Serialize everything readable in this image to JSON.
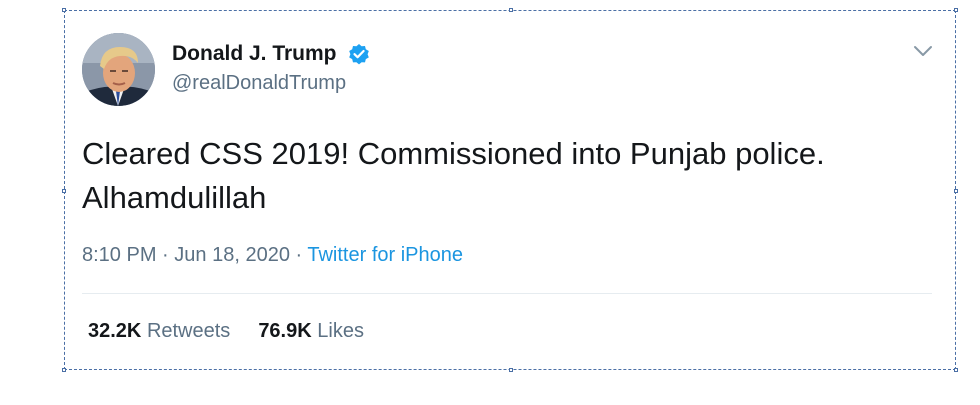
{
  "tweet": {
    "display_name": "Donald J. Trump",
    "handle": "@realDonaldTrump",
    "verified": true,
    "text_line1": "Cleared CSS 2019! Commissioned into Punjab police.",
    "text_line2": "Alhamdulillah",
    "time": "8:10 PM",
    "separator": "·",
    "date": "Jun 18, 2020",
    "source": "Twitter for iPhone",
    "retweets_count": "32.2K",
    "retweets_label": "Retweets",
    "likes_count": "76.9K",
    "likes_label": "Likes"
  },
  "icons": {
    "verified": "verified-badge-icon",
    "menu": "chevron-down-icon",
    "avatar": "profile-photo"
  },
  "colors": {
    "text_primary": "#14171a",
    "text_secondary": "#5b7083",
    "link": "#1b95e0",
    "verified": "#1da1f2",
    "divider": "#e6ecf0",
    "selection_frame": "#4a6fa5"
  }
}
